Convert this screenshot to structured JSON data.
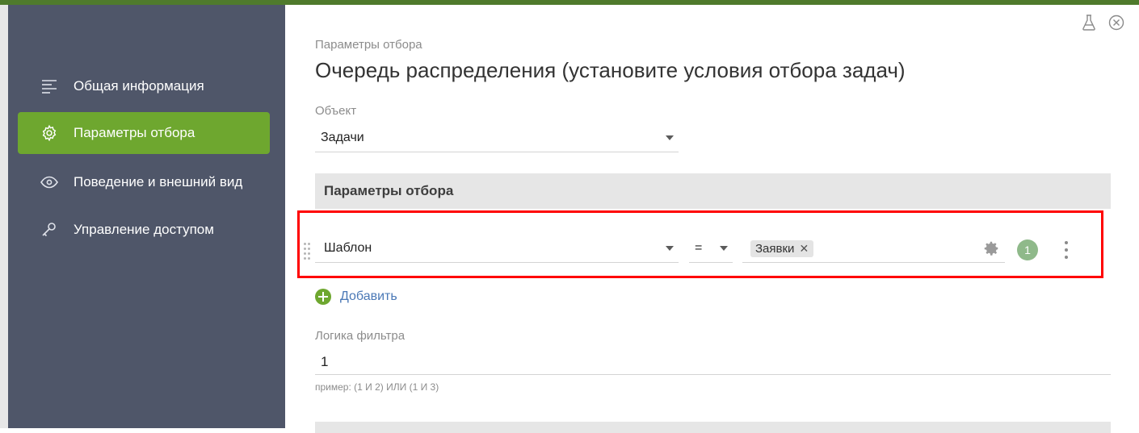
{
  "sidebar": {
    "items": [
      {
        "label": "Общая информация",
        "icon": "list-lines-icon",
        "active": false
      },
      {
        "label": "Параметры отбора",
        "icon": "gear-icon",
        "active": true
      },
      {
        "label": "Поведение и внешний вид",
        "icon": "eye-icon",
        "active": false
      },
      {
        "label": "Управление доступом",
        "icon": "key-icon",
        "active": false
      }
    ]
  },
  "header": {
    "breadcrumb": "Параметры отбора",
    "title": "Очередь распределения (установите условия отбора задач)",
    "icons": [
      "flask-icon",
      "close-circle-icon"
    ]
  },
  "object": {
    "label": "Объект",
    "value": "Задачи"
  },
  "filters": {
    "section_title": "Параметры отбора",
    "condition": {
      "field": "Шаблон",
      "operator": "=",
      "tags": [
        "Заявки"
      ],
      "tag_remove": "✕",
      "count": "1"
    },
    "add_label": "Добавить"
  },
  "logic": {
    "label": "Логика фильтра",
    "value": "1",
    "hint": "пример: (1 И 2) ИЛИ (1 И 3)"
  },
  "colors": {
    "accent": "#6ea72f",
    "sidebar": "#4f5669",
    "highlight": "#ff0000",
    "link": "#4a78b6"
  }
}
